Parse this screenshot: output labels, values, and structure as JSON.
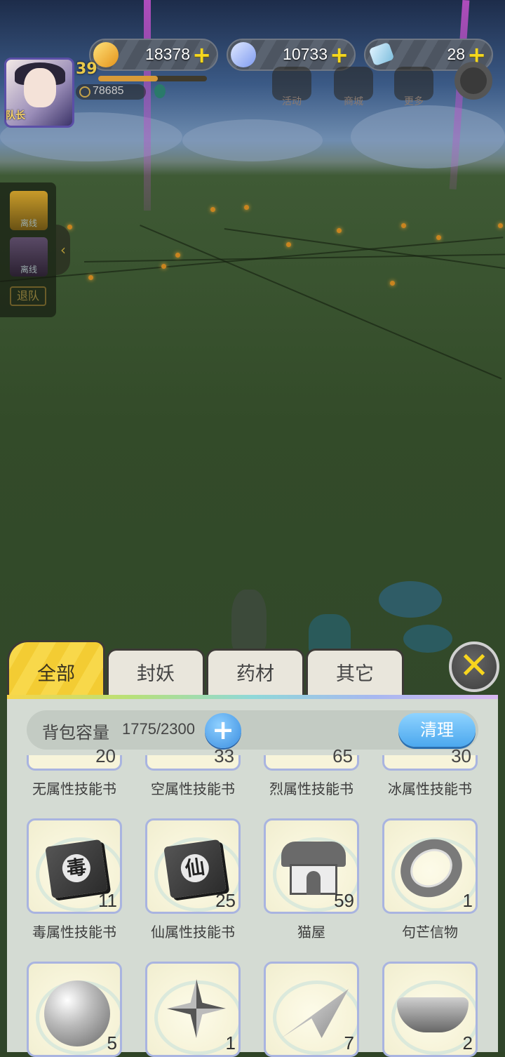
{
  "hud": {
    "currencies": [
      {
        "name": "crystal",
        "amount": "18378",
        "plus": "+",
        "color": "#f0b534"
      },
      {
        "name": "diamond",
        "amount": "10733",
        "plus": "+",
        "color": "#8aa6f0"
      },
      {
        "name": "ticket",
        "amount": "28",
        "plus": "+",
        "color": "#6fb8d8"
      }
    ],
    "player": {
      "level": "39",
      "coins": "78685",
      "badge": "队长"
    },
    "menu": [
      {
        "label": "活动"
      },
      {
        "label": "商城"
      },
      {
        "label": "更多"
      }
    ]
  },
  "team": {
    "members": [
      {
        "status": "离线"
      },
      {
        "status": "离线"
      }
    ],
    "leave_label": "退队",
    "collapse_glyph": "‹"
  },
  "bag": {
    "tabs": [
      {
        "label": "全部",
        "active": true
      },
      {
        "label": "封妖"
      },
      {
        "label": "药材"
      },
      {
        "label": "其它"
      }
    ],
    "close_glyph": "✕",
    "capacity": {
      "label": "背包容量",
      "value": "1775/2300",
      "plus": "+"
    },
    "clean_label": "清理",
    "partial_row": [
      {
        "name": "无属性技能书",
        "count": "20"
      },
      {
        "name": "空属性技能书",
        "count": "33"
      },
      {
        "name": "烈属性技能书",
        "count": "65"
      },
      {
        "name": "冰属性技能书",
        "count": "30"
      }
    ],
    "row2": [
      {
        "name": "毒属性技能书",
        "count": "11",
        "glyph": "毒",
        "icon": "book-icon"
      },
      {
        "name": "仙属性技能书",
        "count": "25",
        "glyph": "仙",
        "icon": "book-icon"
      },
      {
        "name": "猫屋",
        "count": "59",
        "icon": "cat-house-icon"
      },
      {
        "name": "句芒信物",
        "count": "1",
        "icon": "ring-icon"
      }
    ],
    "row3": [
      {
        "count": "5",
        "icon": "pearl-icon"
      },
      {
        "count": "1",
        "icon": "pinwheel-icon"
      },
      {
        "count": "7",
        "icon": "paper-plane-icon"
      },
      {
        "count": "2",
        "icon": "boat-icon"
      }
    ]
  }
}
